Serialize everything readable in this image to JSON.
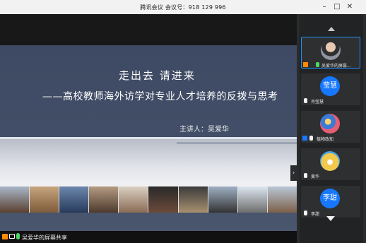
{
  "window": {
    "title": "腾讯会议 会议号：918 129 996"
  },
  "slide": {
    "title_main": "走出去  请进来",
    "title_sub": "——高校教师海外访学对专业人才培养的反拨与思考",
    "lecturer": "主讲人：吴爱华"
  },
  "share_bar": {
    "label": "吴爱华的屏幕共享"
  },
  "participants": [
    {
      "name": "吴爱华的屏幕...",
      "avatar_text": "",
      "avatar_color": "#6b6f78",
      "active": true
    },
    {
      "name": "肖莹慧",
      "avatar_text": "莹慧",
      "avatar_color": "#1677ff",
      "active": false
    },
    {
      "name": "植物政知",
      "avatar_text": "",
      "avatar_color": "#3a7bd5",
      "active": false
    },
    {
      "name": "黄华",
      "avatar_text": "",
      "avatar_color": "#f2c94c",
      "active": false
    },
    {
      "name": "李甜",
      "avatar_text": "李甜",
      "avatar_color": "#1677ff",
      "active": false
    }
  ]
}
